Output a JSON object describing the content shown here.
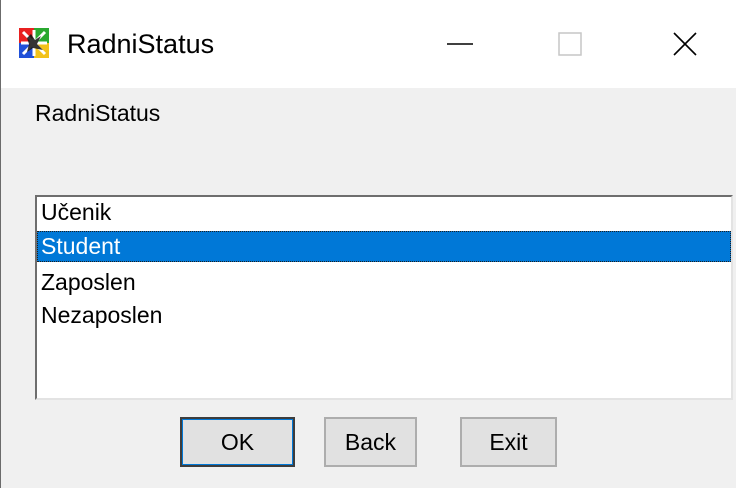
{
  "window": {
    "title": "RadniStatus",
    "controls": [
      "minimize-icon",
      "maximize-icon",
      "close-icon"
    ]
  },
  "form": {
    "label": "RadniStatus"
  },
  "listbox": {
    "items": [
      "Učenik",
      "Student",
      "Zaposlen",
      "Nezaposlen"
    ],
    "selected_index": 1,
    "selected_value": "Student"
  },
  "buttons": {
    "ok_label": "OK",
    "back_label": "Back",
    "exit_label": "Exit"
  },
  "colors": {
    "selection": "#0078d7",
    "window_bg": "#f0f0f0",
    "titlebar_bg": "#ffffff"
  }
}
